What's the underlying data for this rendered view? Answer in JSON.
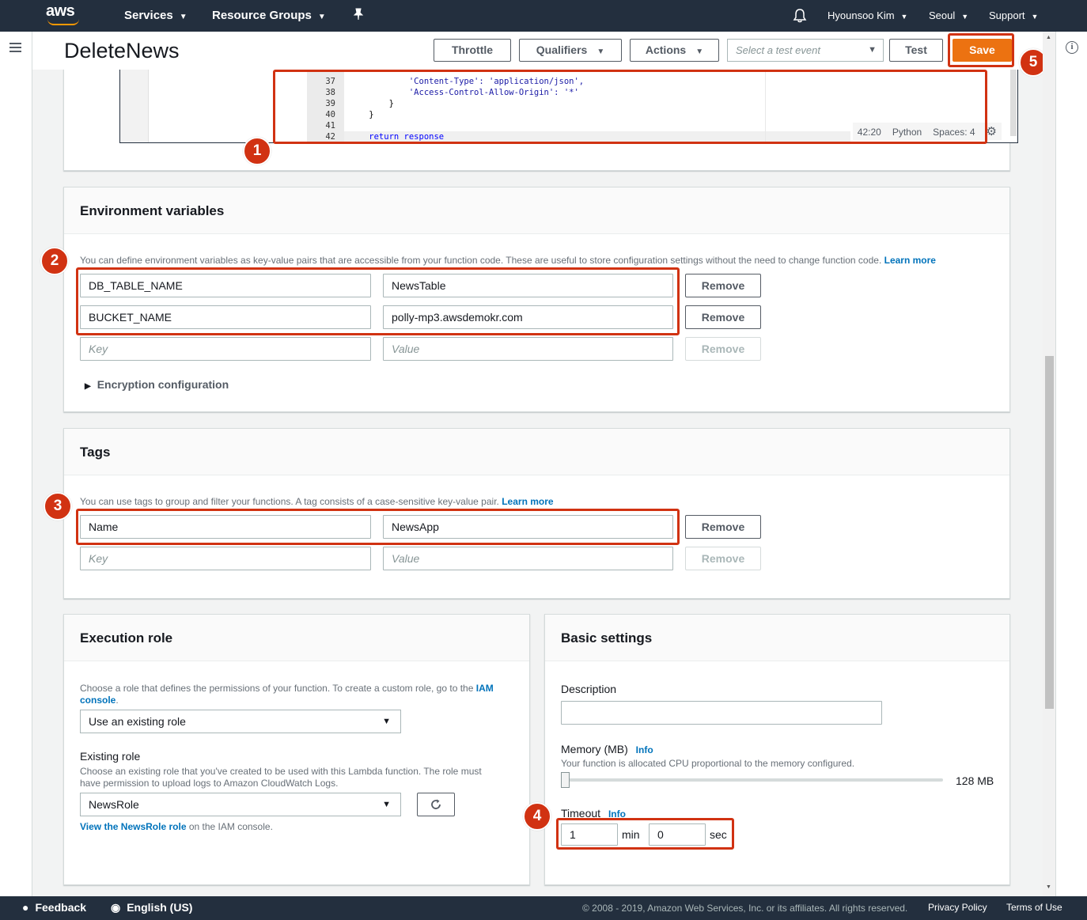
{
  "nav": {
    "logo": "aws",
    "services": "Services",
    "resource_groups": "Resource Groups",
    "pin_icon": "pin-icon",
    "bell_icon": "bell-icon",
    "user": "Hyounsoo Kim",
    "region": "Seoul",
    "support": "Support"
  },
  "header": {
    "title": "DeleteNews",
    "throttle": "Throttle",
    "qualifiers": "Qualifiers",
    "actions": "Actions",
    "test_event_placeholder": "Select a test event",
    "test": "Test",
    "save": "Save"
  },
  "editor": {
    "lines": [
      {
        "num": "37",
        "code": "            'Content-Type': 'application/json',"
      },
      {
        "num": "38",
        "code": "            'Access-Control-Allow-Origin': '*'"
      },
      {
        "num": "39",
        "code": "        }"
      },
      {
        "num": "40",
        "code": "    }"
      },
      {
        "num": "41",
        "code": ""
      },
      {
        "num": "42",
        "code": "    return response"
      }
    ],
    "position": "42:20",
    "language": "Python",
    "spaces": "Spaces: 4"
  },
  "env": {
    "title": "Environment variables",
    "description": "You can define environment variables as key-value pairs that are accessible from your function code. These are useful to store configuration settings without the need to change function code.",
    "learn_more": "Learn more",
    "rows": [
      {
        "key": "DB_TABLE_NAME",
        "value": "NewsTable",
        "remove": "Remove"
      },
      {
        "key": "BUCKET_NAME",
        "value": "polly-mp3.awsdemokr.com",
        "remove": "Remove"
      }
    ],
    "key_placeholder": "Key",
    "value_placeholder": "Value",
    "remove": "Remove",
    "encryption": "Encryption configuration"
  },
  "tags": {
    "title": "Tags",
    "description": "You can use tags to group and filter your functions. A tag consists of a case-sensitive key-value pair.",
    "learn_more": "Learn more",
    "rows": [
      {
        "key": "Name",
        "value": "NewsApp",
        "remove": "Remove"
      }
    ],
    "key_placeholder": "Key",
    "value_placeholder": "Value",
    "remove": "Remove"
  },
  "exec_role": {
    "title": "Execution role",
    "description": "Choose a role that defines the permissions of your function. To create a custom role, go to the",
    "iam_link_1": "IAM",
    "iam_link_2": "console",
    "role_select": "Use an existing role",
    "existing_role_label": "Existing role",
    "existing_role_desc_1": "Choose an existing role that you've created to be used with this Lambda function. The role must",
    "existing_role_desc_2": "have permission to upload logs to Amazon CloudWatch Logs.",
    "role_value": "NewsRole",
    "view_link": "View the NewsRole role",
    "view_suffix": "on the IAM console."
  },
  "basic": {
    "title": "Basic settings",
    "description_label": "Description",
    "description_value": "",
    "memory_label": "Memory (MB)",
    "info": "Info",
    "memory_desc": "Your function is allocated CPU proportional to the memory configured.",
    "memory_value": "128 MB",
    "memory_fraction": 0.0,
    "timeout_label": "Timeout",
    "timeout_min": "1",
    "min_unit": "min",
    "timeout_sec": "0",
    "sec_unit": "sec"
  },
  "badges": [
    "1",
    "2",
    "3",
    "4",
    "5"
  ],
  "footer": {
    "feedback": "Feedback",
    "language": "English (US)",
    "copyright": "© 2008 - 2019, Amazon Web Services, Inc. or its affiliates. All rights reserved.",
    "privacy": "Privacy Policy",
    "terms": "Terms of Use"
  },
  "colors": {
    "nav_bg": "#232f3e",
    "save_orange": "#ec7211",
    "highlight_red": "#d13212",
    "link_blue": "#0073bb"
  }
}
